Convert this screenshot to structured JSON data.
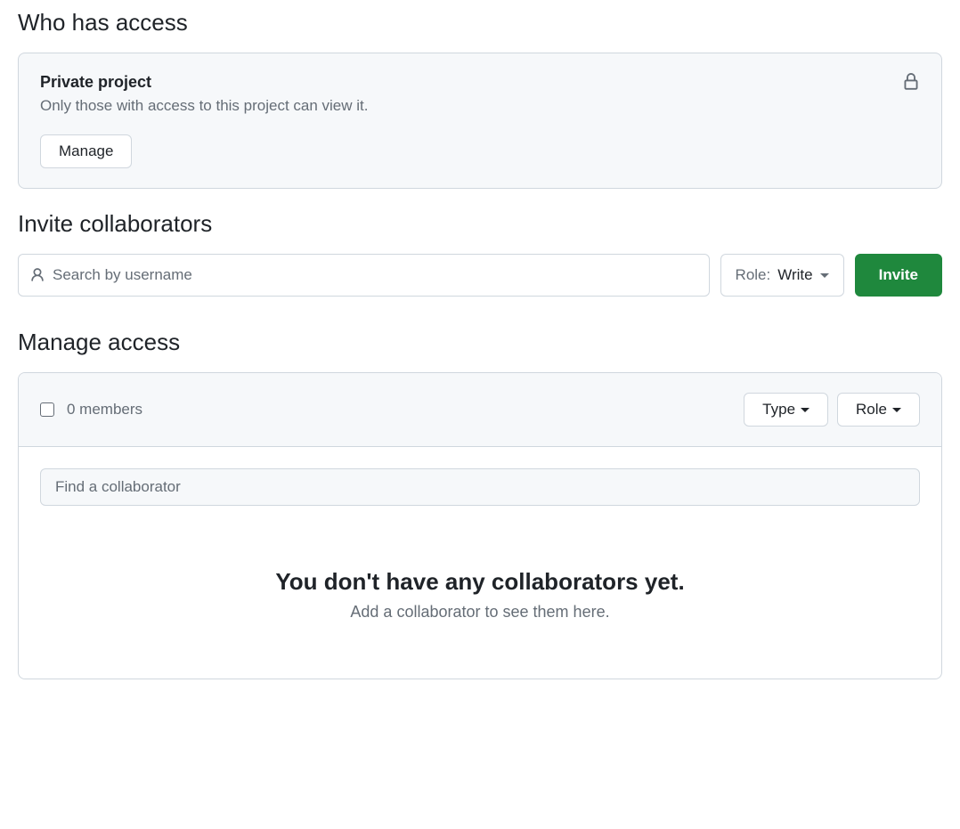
{
  "access": {
    "heading": "Who has access",
    "title": "Private project",
    "description": "Only those with access to this project can view it.",
    "manage_label": "Manage"
  },
  "invite": {
    "heading": "Invite collaborators",
    "search_placeholder": "Search by username",
    "role_prefix": "Role: ",
    "role_value": "Write",
    "invite_label": "Invite"
  },
  "manage": {
    "heading": "Manage access",
    "members_count": "0 members",
    "type_label": "Type",
    "role_label": "Role",
    "find_placeholder": "Find a collaborator",
    "empty_title": "You don't have any collaborators yet.",
    "empty_desc": "Add a collaborator to see them here."
  }
}
